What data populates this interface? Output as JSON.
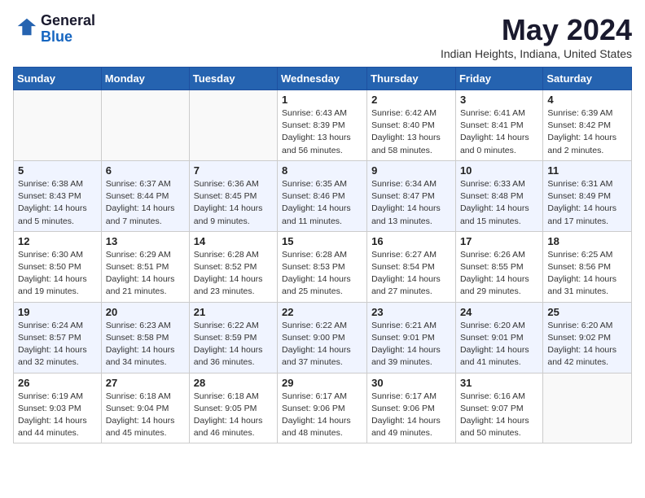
{
  "header": {
    "logo_line1": "General",
    "logo_line2": "Blue",
    "month_title": "May 2024",
    "location": "Indian Heights, Indiana, United States"
  },
  "days_of_week": [
    "Sunday",
    "Monday",
    "Tuesday",
    "Wednesday",
    "Thursday",
    "Friday",
    "Saturday"
  ],
  "weeks": [
    [
      {
        "day": "",
        "info": ""
      },
      {
        "day": "",
        "info": ""
      },
      {
        "day": "",
        "info": ""
      },
      {
        "day": "1",
        "info": "Sunrise: 6:43 AM\nSunset: 8:39 PM\nDaylight: 13 hours\nand 56 minutes."
      },
      {
        "day": "2",
        "info": "Sunrise: 6:42 AM\nSunset: 8:40 PM\nDaylight: 13 hours\nand 58 minutes."
      },
      {
        "day": "3",
        "info": "Sunrise: 6:41 AM\nSunset: 8:41 PM\nDaylight: 14 hours\nand 0 minutes."
      },
      {
        "day": "4",
        "info": "Sunrise: 6:39 AM\nSunset: 8:42 PM\nDaylight: 14 hours\nand 2 minutes."
      }
    ],
    [
      {
        "day": "5",
        "info": "Sunrise: 6:38 AM\nSunset: 8:43 PM\nDaylight: 14 hours\nand 5 minutes."
      },
      {
        "day": "6",
        "info": "Sunrise: 6:37 AM\nSunset: 8:44 PM\nDaylight: 14 hours\nand 7 minutes."
      },
      {
        "day": "7",
        "info": "Sunrise: 6:36 AM\nSunset: 8:45 PM\nDaylight: 14 hours\nand 9 minutes."
      },
      {
        "day": "8",
        "info": "Sunrise: 6:35 AM\nSunset: 8:46 PM\nDaylight: 14 hours\nand 11 minutes."
      },
      {
        "day": "9",
        "info": "Sunrise: 6:34 AM\nSunset: 8:47 PM\nDaylight: 14 hours\nand 13 minutes."
      },
      {
        "day": "10",
        "info": "Sunrise: 6:33 AM\nSunset: 8:48 PM\nDaylight: 14 hours\nand 15 minutes."
      },
      {
        "day": "11",
        "info": "Sunrise: 6:31 AM\nSunset: 8:49 PM\nDaylight: 14 hours\nand 17 minutes."
      }
    ],
    [
      {
        "day": "12",
        "info": "Sunrise: 6:30 AM\nSunset: 8:50 PM\nDaylight: 14 hours\nand 19 minutes."
      },
      {
        "day": "13",
        "info": "Sunrise: 6:29 AM\nSunset: 8:51 PM\nDaylight: 14 hours\nand 21 minutes."
      },
      {
        "day": "14",
        "info": "Sunrise: 6:28 AM\nSunset: 8:52 PM\nDaylight: 14 hours\nand 23 minutes."
      },
      {
        "day": "15",
        "info": "Sunrise: 6:28 AM\nSunset: 8:53 PM\nDaylight: 14 hours\nand 25 minutes."
      },
      {
        "day": "16",
        "info": "Sunrise: 6:27 AM\nSunset: 8:54 PM\nDaylight: 14 hours\nand 27 minutes."
      },
      {
        "day": "17",
        "info": "Sunrise: 6:26 AM\nSunset: 8:55 PM\nDaylight: 14 hours\nand 29 minutes."
      },
      {
        "day": "18",
        "info": "Sunrise: 6:25 AM\nSunset: 8:56 PM\nDaylight: 14 hours\nand 31 minutes."
      }
    ],
    [
      {
        "day": "19",
        "info": "Sunrise: 6:24 AM\nSunset: 8:57 PM\nDaylight: 14 hours\nand 32 minutes."
      },
      {
        "day": "20",
        "info": "Sunrise: 6:23 AM\nSunset: 8:58 PM\nDaylight: 14 hours\nand 34 minutes."
      },
      {
        "day": "21",
        "info": "Sunrise: 6:22 AM\nSunset: 8:59 PM\nDaylight: 14 hours\nand 36 minutes."
      },
      {
        "day": "22",
        "info": "Sunrise: 6:22 AM\nSunset: 9:00 PM\nDaylight: 14 hours\nand 37 minutes."
      },
      {
        "day": "23",
        "info": "Sunrise: 6:21 AM\nSunset: 9:01 PM\nDaylight: 14 hours\nand 39 minutes."
      },
      {
        "day": "24",
        "info": "Sunrise: 6:20 AM\nSunset: 9:01 PM\nDaylight: 14 hours\nand 41 minutes."
      },
      {
        "day": "25",
        "info": "Sunrise: 6:20 AM\nSunset: 9:02 PM\nDaylight: 14 hours\nand 42 minutes."
      }
    ],
    [
      {
        "day": "26",
        "info": "Sunrise: 6:19 AM\nSunset: 9:03 PM\nDaylight: 14 hours\nand 44 minutes."
      },
      {
        "day": "27",
        "info": "Sunrise: 6:18 AM\nSunset: 9:04 PM\nDaylight: 14 hours\nand 45 minutes."
      },
      {
        "day": "28",
        "info": "Sunrise: 6:18 AM\nSunset: 9:05 PM\nDaylight: 14 hours\nand 46 minutes."
      },
      {
        "day": "29",
        "info": "Sunrise: 6:17 AM\nSunset: 9:06 PM\nDaylight: 14 hours\nand 48 minutes."
      },
      {
        "day": "30",
        "info": "Sunrise: 6:17 AM\nSunset: 9:06 PM\nDaylight: 14 hours\nand 49 minutes."
      },
      {
        "day": "31",
        "info": "Sunrise: 6:16 AM\nSunset: 9:07 PM\nDaylight: 14 hours\nand 50 minutes."
      },
      {
        "day": "",
        "info": ""
      }
    ]
  ]
}
